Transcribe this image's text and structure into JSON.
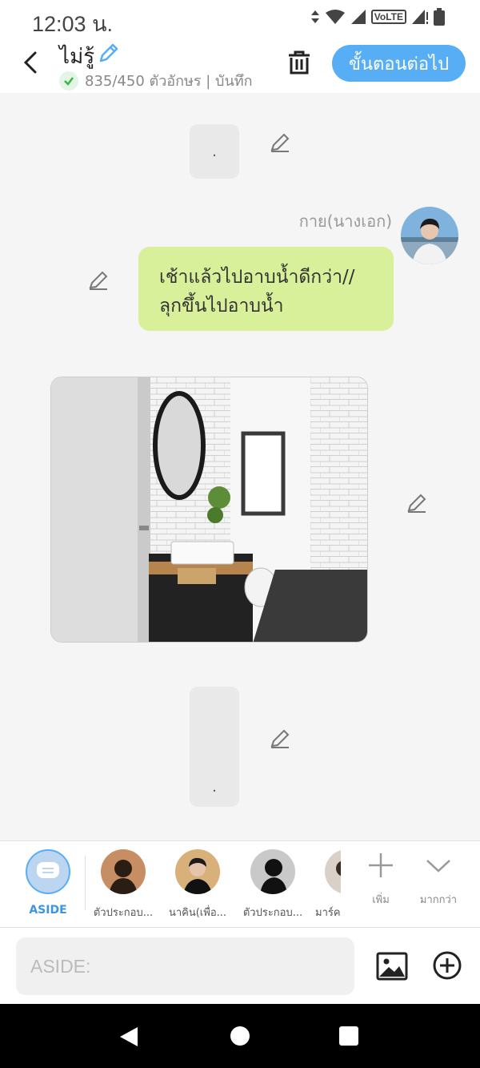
{
  "status": {
    "time": "12:03 น.",
    "volte": "VoLTE"
  },
  "header": {
    "title": "ไม่รู้",
    "char_count": "835/450 ตัวอักษร | บันทึก",
    "next_label": "ขั้นตอนต่อไป"
  },
  "chat": {
    "top_bubble": ".",
    "sender": "กาย(นางเอก)",
    "message": "เช้าแล้วไปอาบน้ำดีกว่า//ลุกขึ้นไปอาบน้ำ",
    "bottom_bubble": "."
  },
  "characters": [
    {
      "label": "ASIDE"
    },
    {
      "label": "ตัวประกอบ..."
    },
    {
      "label": "นาคิน(เพื่อ..."
    },
    {
      "label": "ตัวประกอบ..."
    },
    {
      "label": "มาร์ค..."
    }
  ],
  "actions": {
    "add_label": "เพิ่ม",
    "more_label": "มากกว่า"
  },
  "input": {
    "placeholder": "ASIDE:"
  },
  "colors": {
    "accent": "#58aef5",
    "message_bg": "#d9f09b"
  }
}
